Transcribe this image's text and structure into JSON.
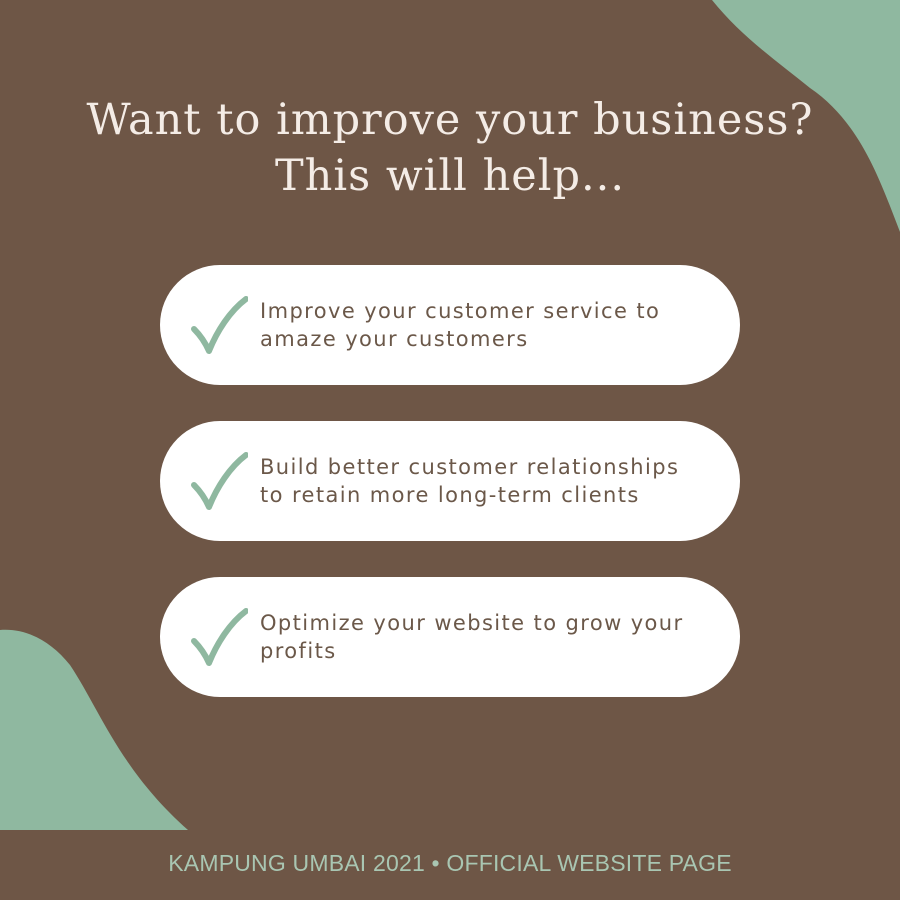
{
  "headline": {
    "line1": "Want to improve your business?",
    "line2": "This will help..."
  },
  "benefits": [
    {
      "text": "Improve your customer service to amaze your customers",
      "icon": "checkmark-icon"
    },
    {
      "text": "Build better customer relationships to retain more long-term clients",
      "icon": "checkmark-icon"
    },
    {
      "text": "Optimize your website to grow your profits",
      "icon": "checkmark-icon"
    }
  ],
  "footer": "KAMPUNG UMBAI 2021 • OFFICIAL WEBSITE PAGE",
  "colors": {
    "background": "#6e5646",
    "accent": "#8fb8a0",
    "card": "#ffffff",
    "text_light": "#f4ece6",
    "text_dark": "#6b5849",
    "footer_text": "#a9c6b2"
  }
}
